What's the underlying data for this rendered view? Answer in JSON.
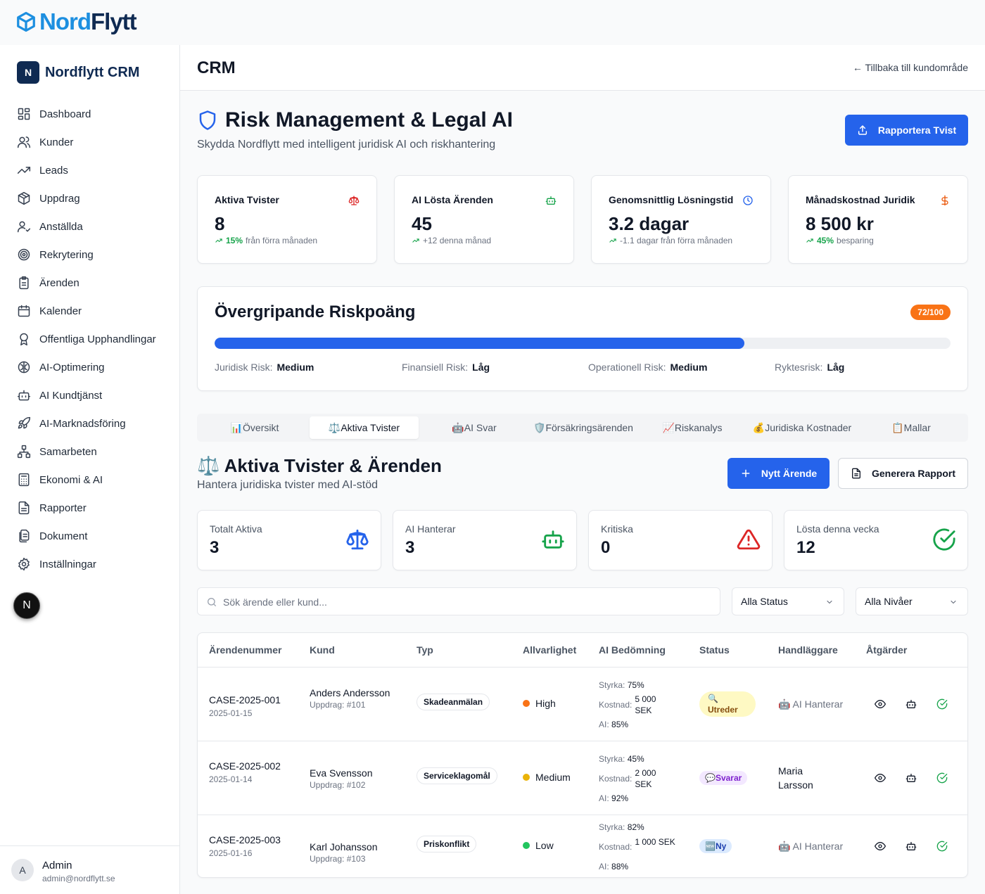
{
  "topbar": {
    "logo_part1": "Nord",
    "logo_part2": "Flytt"
  },
  "sidebar": {
    "brand_letter": "N",
    "brand_name": "Nordflytt CRM",
    "items": [
      {
        "label": "Dashboard",
        "icon": "dashboard-icon"
      },
      {
        "label": "Kunder",
        "icon": "users-icon"
      },
      {
        "label": "Leads",
        "icon": "trending-up-icon"
      },
      {
        "label": "Uppdrag",
        "icon": "package-icon"
      },
      {
        "label": "Anställda",
        "icon": "user-check-icon"
      },
      {
        "label": "Rekrytering",
        "icon": "target-icon"
      },
      {
        "label": "Ärenden",
        "icon": "clipboard-icon"
      },
      {
        "label": "Kalender",
        "icon": "calendar-icon"
      },
      {
        "label": "Offentliga Upphandlingar",
        "icon": "award-icon"
      },
      {
        "label": "AI-Optimering",
        "icon": "brain-icon"
      },
      {
        "label": "AI Kundtjänst",
        "icon": "bot-icon"
      },
      {
        "label": "AI-Marknadsföring",
        "icon": "rocket-icon"
      },
      {
        "label": "Samarbeten",
        "icon": "network-icon"
      },
      {
        "label": "Ekonomi & AI",
        "icon": "calculator-icon"
      },
      {
        "label": "Rapporter",
        "icon": "file-text-icon"
      },
      {
        "label": "Dokument",
        "icon": "files-icon"
      },
      {
        "label": "Inställningar",
        "icon": "settings-icon"
      }
    ],
    "dev_badge": "N",
    "user": {
      "avatar": "A",
      "name": "Admin",
      "email": "admin@nordflytt.se"
    }
  },
  "header": {
    "title": "CRM",
    "back_link": "← Tillbaka till kundområde"
  },
  "page": {
    "title": "Risk Management & Legal AI",
    "subtitle": "Skydda Nordflytt med intelligent juridisk AI och riskhantering",
    "report_button": "Rapportera Tvist"
  },
  "stats": [
    {
      "label": "Aktiva Tvister",
      "value": "8",
      "change": "15%",
      "suffix": "från förra månaden",
      "icon": "scale-icon",
      "color": "#dc2626"
    },
    {
      "label": "AI Lösta Ärenden",
      "value": "45",
      "change": "",
      "suffix": "+12 denna månad",
      "icon": "bot-icon",
      "color": "#16a34a"
    },
    {
      "label": "Genomsnittlig Lösningstid",
      "value": "3.2 dagar",
      "change": "",
      "suffix": "-1.1 dagar från förra månaden",
      "icon": "clock-icon",
      "color": "#2563eb"
    },
    {
      "label": "Månadskostnad Juridik",
      "value": "8 500 kr",
      "change": "45%",
      "suffix": "besparing",
      "icon": "dollar-icon",
      "color": "#ea580c"
    }
  ],
  "risk": {
    "title": "Övergripande Riskpoäng",
    "badge": "72/100",
    "score": 72,
    "items": [
      {
        "label": "Juridisk Risk:",
        "value": "Medium"
      },
      {
        "label": "Finansiell Risk:",
        "value": "Låg"
      },
      {
        "label": "Operationell Risk:",
        "value": "Medium"
      },
      {
        "label": "Ryktesrisk:",
        "value": "Låg"
      }
    ]
  },
  "tabs": [
    "📊Översikt",
    "⚖️Aktiva Tvister",
    "🤖AI Svar",
    "🛡️Försäkringsärenden",
    "📈Riskanalys",
    "💰Juridiska Kostnader",
    "📋Mallar"
  ],
  "section": {
    "title": "⚖️ Aktiva Tvister & Ärenden",
    "subtitle": "Hantera juridiska tvister med AI-stöd",
    "new_button": "Nytt Ärende",
    "report_button": "Generera Rapport"
  },
  "mini_stats": [
    {
      "label": "Totalt Aktiva",
      "value": "3",
      "icon": "scale-icon",
      "color": "#2563eb"
    },
    {
      "label": "AI Hanterar",
      "value": "3",
      "icon": "bot-icon",
      "color": "#16a34a"
    },
    {
      "label": "Kritiska",
      "value": "0",
      "icon": "alert-triangle-icon",
      "color": "#dc2626"
    },
    {
      "label": "Lösta denna vecka",
      "value": "12",
      "icon": "check-circle-icon",
      "color": "#16a34a"
    }
  ],
  "filters": {
    "search_placeholder": "Sök ärende eller kund...",
    "status": "Alla Status",
    "level": "Alla Nivåer"
  },
  "table": {
    "headers": [
      "Ärendenummer",
      "Kund",
      "Typ",
      "Allvarlighet",
      "AI Bedömning",
      "Status",
      "Handläggare",
      "Åtgärder"
    ],
    "ai_labels": {
      "strength": "Styrka:",
      "cost": "Kostnad:",
      "ai": "AI:"
    },
    "rows": [
      {
        "id": "CASE-2025-001",
        "date": "2025-01-15",
        "customer": "Anders Andersson",
        "job": "Uppdrag: #101",
        "type": "Skadeanmälan",
        "severity": "High",
        "severity_color": "#f97316",
        "strength": "75%",
        "cost": "5 000 SEK",
        "ai": "85%",
        "status": "🔍 Utreder",
        "status_bg": "#fef9c3",
        "status_fg": "#854d0e",
        "handler": "🤖 AI Hanterar"
      },
      {
        "id": "CASE-2025-002",
        "date": "2025-01-14",
        "customer": "Eva Svensson",
        "job": "Uppdrag: #102",
        "type": "Serviceklagomål",
        "severity": "Medium",
        "severity_color": "#eab308",
        "strength": "45%",
        "cost": "2 000 SEK",
        "ai": "92%",
        "status": "💬Svarar",
        "status_bg": "#f3e8ff",
        "status_fg": "#7e22ce",
        "handler": "Maria Larsson"
      },
      {
        "id": "CASE-2025-003",
        "date": "2025-01-16",
        "customer": "Karl Johansson",
        "job": "Uppdrag: #103",
        "type": "Priskonflikt",
        "severity": "Low",
        "severity_color": "#22c55e",
        "strength": "82%",
        "cost": "1 000 SEK",
        "ai": "88%",
        "status": "🆕Ny",
        "status_bg": "#dbeafe",
        "status_fg": "#1e40af",
        "handler": "🤖 AI Hanterar"
      }
    ]
  }
}
